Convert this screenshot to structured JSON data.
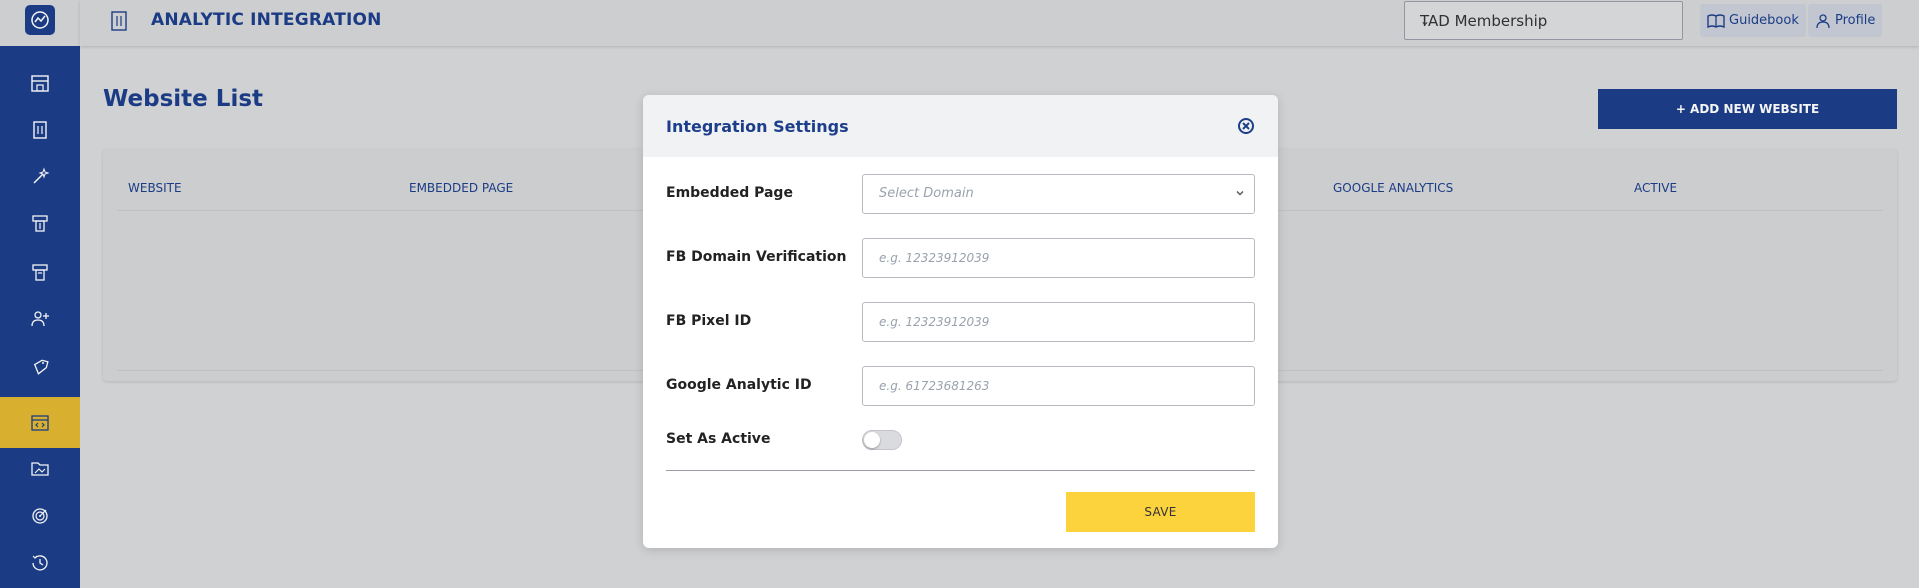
{
  "header": {
    "title": "ANALYTIC INTEGRATION",
    "membership_select": "TAD Membership",
    "guidebook_label": "Guidebook",
    "profile_label": "Profile"
  },
  "sidebar": {
    "items": [
      {
        "icon": "store-icon"
      },
      {
        "icon": "menu-card-icon"
      },
      {
        "icon": "magic-wand-icon"
      },
      {
        "icon": "ticket-icon"
      },
      {
        "icon": "ticket-alt-icon"
      },
      {
        "icon": "add-user-icon"
      },
      {
        "icon": "tag-icon"
      },
      {
        "icon": "code-window-icon",
        "active": true
      },
      {
        "icon": "folder-image-icon"
      },
      {
        "icon": "target-icon"
      },
      {
        "icon": "history-icon"
      }
    ],
    "active_color": "#e2b731",
    "background": "#1d3f8b"
  },
  "main": {
    "page_title": "Website List",
    "add_button": "+ ADD NEW WEBSITE",
    "table": {
      "columns": [
        "WEBSITE",
        "EMBEDDED PAGE",
        "GOOGLE ANALYTICS",
        "ACTIVE"
      ],
      "rows": []
    }
  },
  "modal": {
    "title": "Integration Settings",
    "fields": {
      "embedded_page": {
        "label": "Embedded Page",
        "placeholder": "Select Domain"
      },
      "fb_domain": {
        "label": "FB Domain Verification",
        "placeholder": "e.g. 12323912039"
      },
      "fb_pixel": {
        "label": "FB Pixel ID",
        "placeholder": "e.g. 12323912039"
      },
      "google_analytic": {
        "label": "Google Analytic ID",
        "placeholder": "e.g. 61723681263"
      },
      "set_active": {
        "label": "Set As Active",
        "value": false
      }
    },
    "save_label": "SAVE"
  },
  "colors": {
    "primary": "#1d3f8b",
    "accent": "#fcd23d"
  }
}
